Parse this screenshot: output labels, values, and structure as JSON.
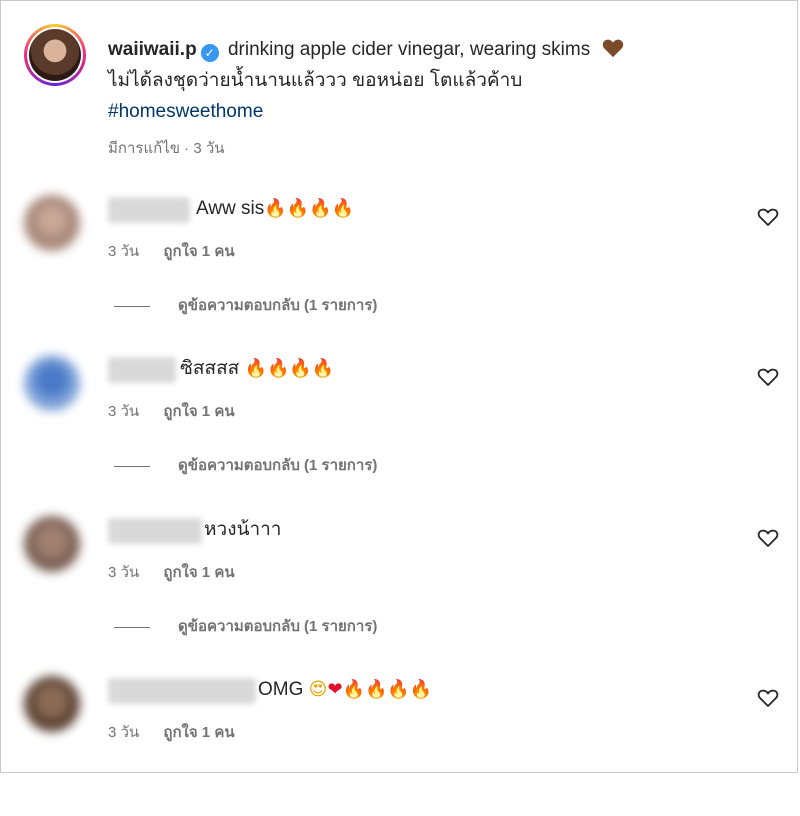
{
  "post": {
    "username": "waiiwaii.p",
    "caption_line1": "drinking apple cider vinegar, wearing skims",
    "caption_line2": "ไม่ได้ลงชุดว่ายน้ำนานแล้ววว ขอหน่อย โตแล้วค้าบ",
    "hashtag": "#homesweethome",
    "meta": "มีการแก้ไข · 3 วัน"
  },
  "comments": [
    {
      "text": "Aww sis",
      "emojis": "🔥🔥🔥🔥",
      "time": "3 วัน",
      "likes": "ถูกใจ 1 คน",
      "replies": "ดูข้อความตอบกลับ (1 รายการ)"
    },
    {
      "text": "ซิสสสส ",
      "emojis": "🔥🔥🔥🔥",
      "time": "3 วัน",
      "likes": "ถูกใจ 1 คน",
      "replies": "ดูข้อความตอบกลับ (1 รายการ)"
    },
    {
      "text": "หวงน้าาา",
      "emojis": "",
      "time": "3 วัน",
      "likes": "ถูกใจ 1 คน",
      "replies": "ดูข้อความตอบกลับ (1 รายการ)"
    },
    {
      "text": "OMG ",
      "emojis_smile": "😍",
      "emojis_heart": "❤",
      "emojis": "🔥🔥🔥🔥",
      "time": "3 วัน",
      "likes": "ถูกใจ 1 คน"
    }
  ],
  "icons": {
    "verified": "verified-badge-icon",
    "like": "heart-outline-icon",
    "caption_heart": "brown-heart-icon"
  },
  "colors": {
    "verified": "#3897f0",
    "hashtag": "#00376b",
    "muted": "#737373"
  }
}
